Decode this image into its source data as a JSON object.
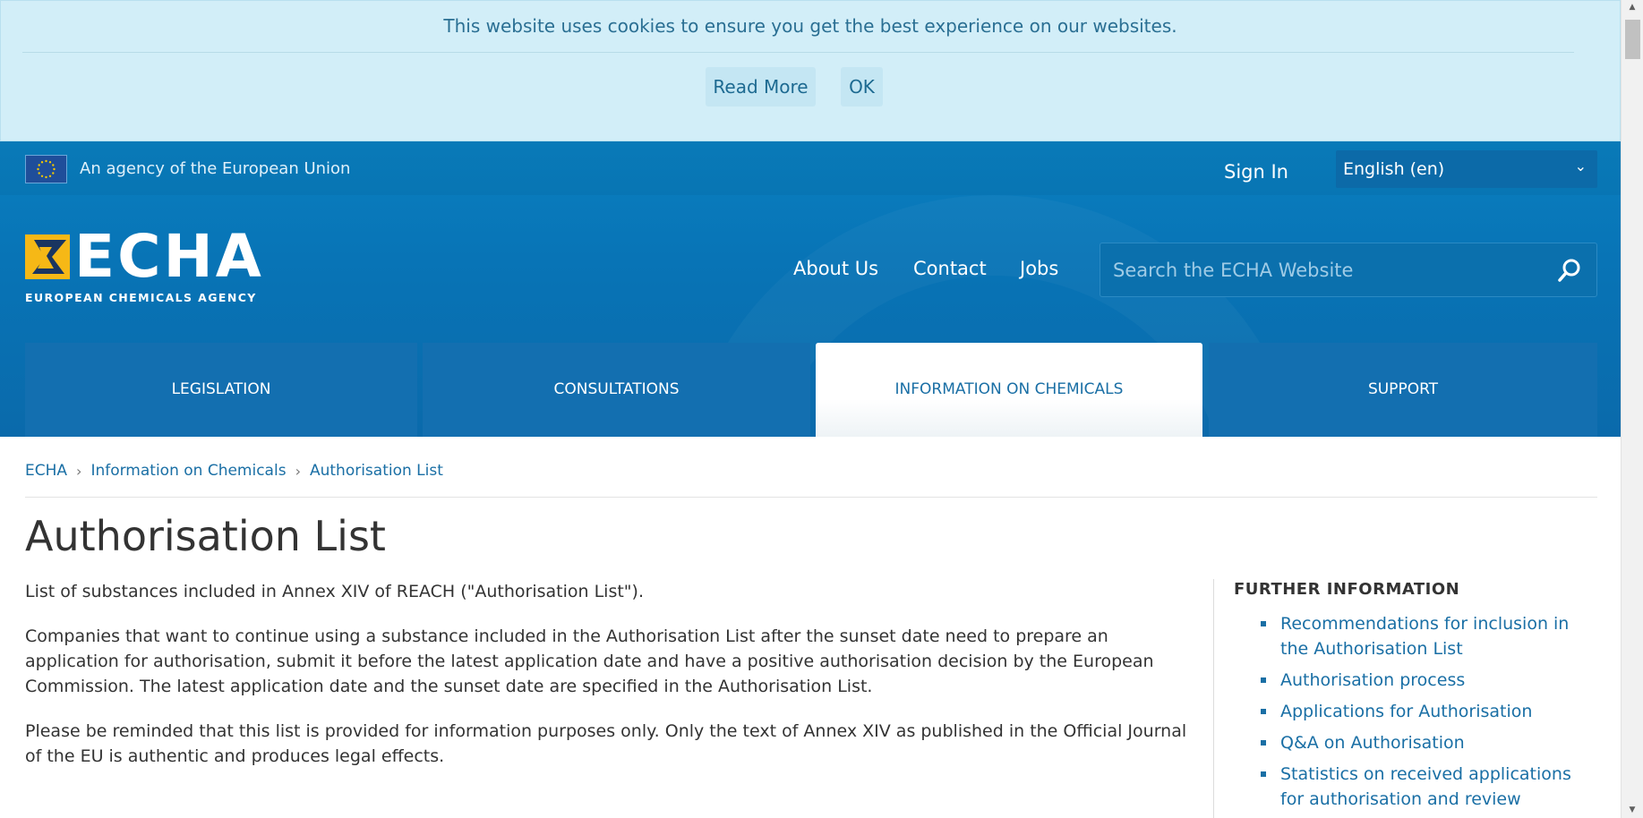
{
  "cookie": {
    "message": "This website uses cookies to ensure you get the best experience on our websites.",
    "read_more": "Read More",
    "ok": "OK"
  },
  "topbar": {
    "agency": "An agency of the European Union",
    "sign_in": "Sign In",
    "language": "English (en)"
  },
  "logo": {
    "word": "ECHA",
    "subtitle": "EUROPEAN CHEMICALS AGENCY"
  },
  "nav": {
    "about": "About Us",
    "contact": "Contact",
    "jobs": "Jobs"
  },
  "search": {
    "placeholder": "Search the ECHA Website"
  },
  "tabs": [
    {
      "label": "LEGISLATION",
      "active": false
    },
    {
      "label": "CONSULTATIONS",
      "active": false
    },
    {
      "label": "INFORMATION ON CHEMICALS",
      "active": true
    },
    {
      "label": "SUPPORT",
      "active": false
    }
  ],
  "breadcrumb": [
    "ECHA",
    "Information on Chemicals",
    "Authorisation List"
  ],
  "page": {
    "title": "Authorisation List",
    "paragraphs": [
      "List of substances included in Annex XIV of REACH (\"Authorisation List\").",
      "Companies that want to continue using a substance included in the Authorisation List after the sunset date need to prepare an application for authorisation, submit it before the latest application date and have a positive authorisation decision by the European Commission. The latest application date and the sunset date are specified in the Authorisation List.",
      "Please be reminded that this list is provided for information purposes only. Only the text of Annex XIV as published in the Official Journal of the EU is authentic and produces legal effects."
    ]
  },
  "sidebar": {
    "title": "FURTHER INFORMATION",
    "links": [
      "Recommendations for inclusion in the Authorisation List",
      "Authorisation process",
      "Applications for Authorisation",
      "Q&A on Authorisation",
      "Statistics on received applications for authorisation and review"
    ]
  },
  "colors": {
    "header_blue": "#0874b6",
    "link_blue": "#1a6fa5",
    "cookie_bg": "#d2eef8",
    "logo_yellow": "#f6b816"
  }
}
